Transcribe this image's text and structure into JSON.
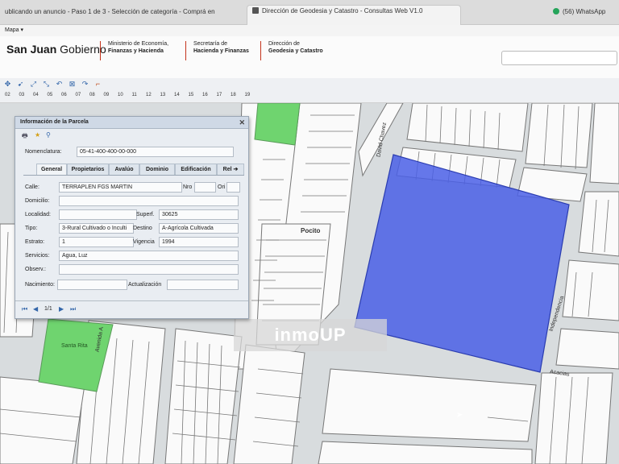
{
  "browser": {
    "tabs": [
      {
        "title": "ublicando un anuncio - Paso 1 de 3 - Selección de categoría - Comprá en San..."
      },
      {
        "title": "Dirección de Geodesia y Catastro - Consultas Web V1.0"
      },
      {
        "title": "(56) WhatsApp"
      }
    ],
    "menu": "Mapa ▾"
  },
  "header": {
    "brand_bold": "San Juan",
    "brand_rest": " Gobierno",
    "block1_line1": "Ministerio de Economía,",
    "block1_line2": "Finanzas y Hacienda",
    "block2_line1": "Secretaría de",
    "block2_line2": "Hacienda y Finanzas",
    "block3_line1": "Dirección de",
    "block3_line2": "Geodesia y Catastro"
  },
  "ruler": [
    "02",
    "03",
    "04",
    "05",
    "06",
    "07",
    "08",
    "09",
    "10",
    "11",
    "12",
    "13",
    "14",
    "15",
    "16",
    "17",
    "18",
    "19"
  ],
  "panel": {
    "title": "Información de la Parcela",
    "nomenclatura_label": "Nomenclatura:",
    "nomenclatura_value": "05-41-400-400-00-000",
    "tabs": [
      "General",
      "Propietarios",
      "Avalúo",
      "Dominio",
      "Edificación",
      "Rel ➔"
    ],
    "calle_label": "Calle:",
    "calle_value": "TERRAPLEN FGS MARTIN",
    "nro_label": "Nro",
    "ori_label": "Ori",
    "domicilio_label": "Domicilio:",
    "localidad_label": "Localidad:",
    "superf_label": "Superf.",
    "superf_value": "30625",
    "tipo_label": "Tipo:",
    "tipo_value": "3-Rural Cultivado o Inculti",
    "destino_label": "Destino",
    "destino_value": "A-Agrícola Cultivada",
    "estrato_label": "Estrato:",
    "estrato_value": "1",
    "vigencia_label": "Vigencia",
    "vigencia_value": "1994",
    "servicios_label": "Servicios:",
    "servicios_value": "Agua, Luz",
    "observ_label": "Observ.:",
    "nacimiento_label": "Nacimiento:",
    "actualizacion_label": "Actualización",
    "pager": "1/1"
  },
  "map": {
    "labels": {
      "david_chavez": "David Chavez",
      "pocito": "Pocito",
      "independencia": "Independencia",
      "acacias": "Acacias",
      "santa_rita": "Santa Rita",
      "avenida": "Avenida A"
    },
    "watermark": "inmoUP",
    "selection_color": "#4a5fe6",
    "green_color": "#6fd46f"
  }
}
